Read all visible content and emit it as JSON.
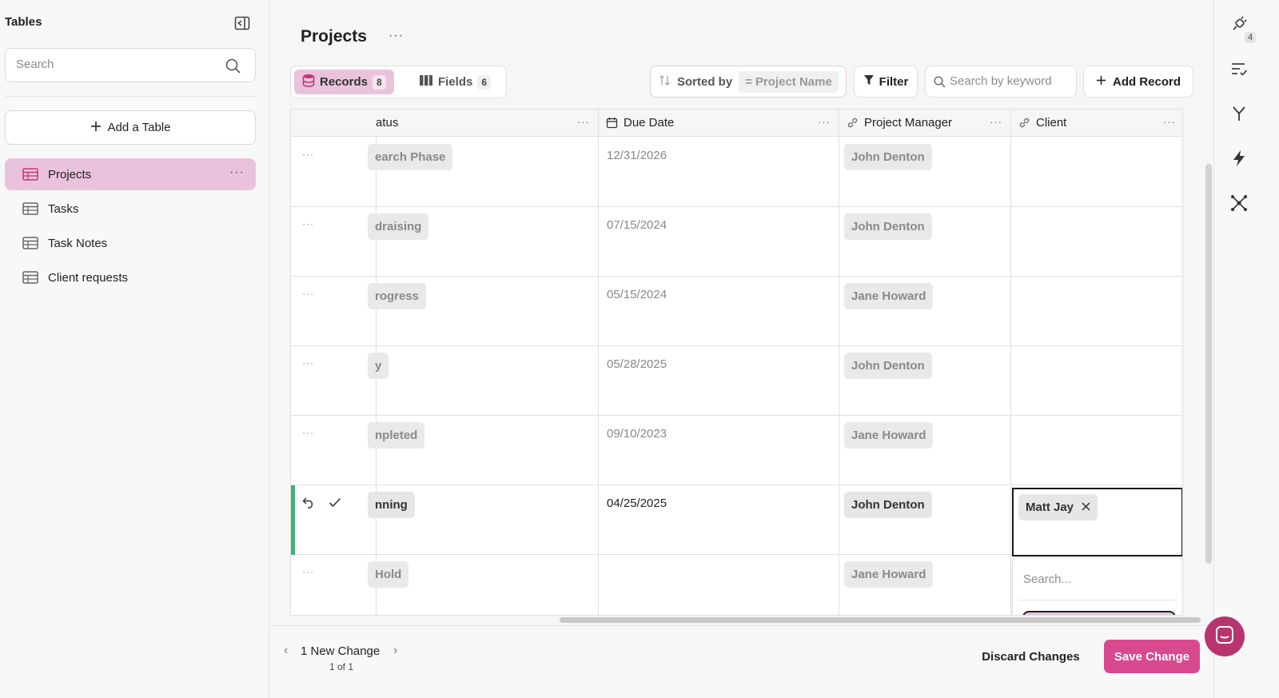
{
  "sidebar": {
    "title": "Tables",
    "search_placeholder": "Search",
    "add_table_label": "Add a Table",
    "items": [
      {
        "label": "Projects",
        "active": true
      },
      {
        "label": "Tasks",
        "active": false
      },
      {
        "label": "Task Notes",
        "active": false
      },
      {
        "label": "Client requests",
        "active": false
      }
    ]
  },
  "header": {
    "title": "Projects",
    "tabs": [
      {
        "label": "Records",
        "count": "8"
      },
      {
        "label": "Fields",
        "count": "6"
      }
    ],
    "sort_label": "Sorted by",
    "sort_field": "Project Name",
    "filter_label": "Filter",
    "keyword_placeholder": "Search by keyword",
    "add_record_label": "Add Record"
  },
  "grid": {
    "columns": [
      "atus",
      "Due Date",
      "Project Manager",
      "Client"
    ],
    "rows": [
      {
        "status": "earch Phase",
        "due": "12/31/2026",
        "manager": "John Denton",
        "client": ""
      },
      {
        "status": "draising",
        "due": "07/15/2024",
        "manager": "John Denton",
        "client": ""
      },
      {
        "status": "rogress",
        "due": "05/15/2024",
        "manager": "Jane Howard",
        "client": ""
      },
      {
        "status": "y",
        "due": "05/28/2025",
        "manager": "John Denton",
        "client": ""
      },
      {
        "status": "npleted",
        "due": "09/10/2023",
        "manager": "Jane Howard",
        "client": ""
      },
      {
        "status": "nning",
        "due": "04/25/2025",
        "manager": "John Denton",
        "client": "Matt Jay"
      },
      {
        "status": "Hold",
        "due": "",
        "manager": "Jane Howard",
        "client": ""
      }
    ],
    "editing_row_index": 5,
    "client_search_placeholder": "Search..."
  },
  "footer": {
    "change_label": "1 New Change",
    "change_count": "1 of 1",
    "discard_label": "Discard Changes",
    "save_label": "Save Change"
  },
  "rail": {
    "badge": "4"
  },
  "colors": {
    "accent_pink": "#e9c3dc",
    "save_button": "#d9498f",
    "edit_indicator": "#3cb371",
    "chat_button": "#b8346f"
  }
}
